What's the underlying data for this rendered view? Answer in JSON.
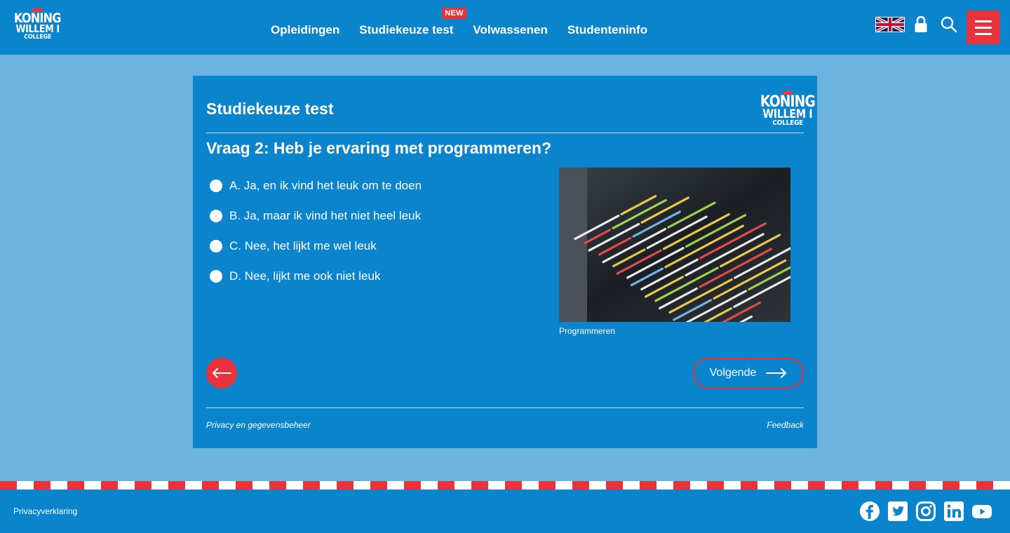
{
  "header": {
    "logo": {
      "line1": "KONING",
      "line2": "WILLEM I",
      "line3": "COLLEGE"
    },
    "nav": [
      {
        "label": "Opleidingen"
      },
      {
        "label": "Studiekeuze test",
        "badge": "NEW"
      },
      {
        "label": "Volwassenen"
      },
      {
        "label": "Studenteninfo"
      }
    ],
    "icons": [
      "uk-flag-icon",
      "lock-icon",
      "search-icon",
      "menu-icon"
    ]
  },
  "card": {
    "title": "Studiekeuze test",
    "logo": {
      "line1": "KONING",
      "line2": "WILLEM I",
      "line3": "COLLEGE"
    },
    "question": "Vraag 2: Heb je ervaring met programmeren?",
    "options": [
      {
        "label": "A. Ja, en ik vind het leuk om te doen"
      },
      {
        "label": "B. Ja, maar ik vind het niet heel leuk"
      },
      {
        "label": "C. Nee, het lijkt me wel leuk"
      },
      {
        "label": "D. Nee, lijkt me ook niet leuk"
      }
    ],
    "image_caption": "Programmeren",
    "next_label": "Volgende",
    "footer_left": "Privacy en gegevensbeheer",
    "footer_right": "Feedback"
  },
  "footer": {
    "link": "Privacyverklaring",
    "social": [
      "facebook-icon",
      "twitter-icon",
      "instagram-icon",
      "linkedin-icon",
      "youtube-icon"
    ]
  },
  "colors": {
    "primary_blue": "#0a84cc",
    "background_light_blue": "#6bb4de",
    "accent_red": "#e8323c"
  }
}
